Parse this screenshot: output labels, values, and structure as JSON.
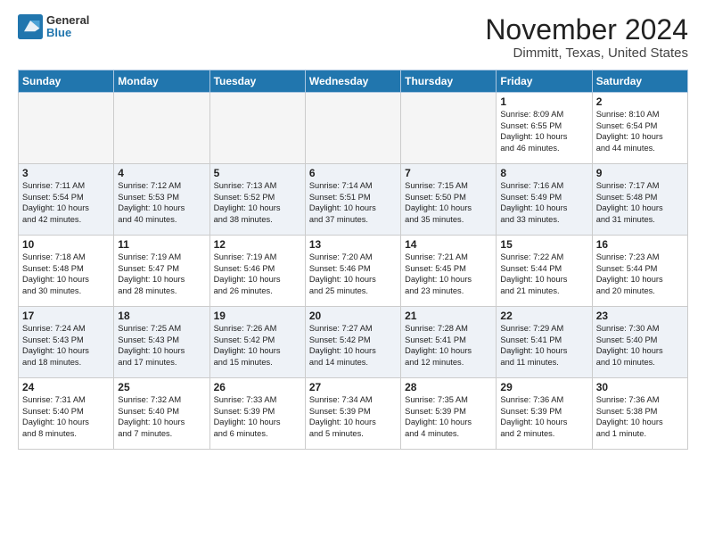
{
  "header": {
    "logo_general": "General",
    "logo_blue": "Blue",
    "title": "November 2024",
    "subtitle": "Dimmitt, Texas, United States"
  },
  "weekdays": [
    "Sunday",
    "Monday",
    "Tuesday",
    "Wednesday",
    "Thursday",
    "Friday",
    "Saturday"
  ],
  "weeks": [
    [
      {
        "day": "",
        "info": ""
      },
      {
        "day": "",
        "info": ""
      },
      {
        "day": "",
        "info": ""
      },
      {
        "day": "",
        "info": ""
      },
      {
        "day": "",
        "info": ""
      },
      {
        "day": "1",
        "info": "Sunrise: 8:09 AM\nSunset: 6:55 PM\nDaylight: 10 hours\nand 46 minutes."
      },
      {
        "day": "2",
        "info": "Sunrise: 8:10 AM\nSunset: 6:54 PM\nDaylight: 10 hours\nand 44 minutes."
      }
    ],
    [
      {
        "day": "3",
        "info": "Sunrise: 7:11 AM\nSunset: 5:54 PM\nDaylight: 10 hours\nand 42 minutes."
      },
      {
        "day": "4",
        "info": "Sunrise: 7:12 AM\nSunset: 5:53 PM\nDaylight: 10 hours\nand 40 minutes."
      },
      {
        "day": "5",
        "info": "Sunrise: 7:13 AM\nSunset: 5:52 PM\nDaylight: 10 hours\nand 38 minutes."
      },
      {
        "day": "6",
        "info": "Sunrise: 7:14 AM\nSunset: 5:51 PM\nDaylight: 10 hours\nand 37 minutes."
      },
      {
        "day": "7",
        "info": "Sunrise: 7:15 AM\nSunset: 5:50 PM\nDaylight: 10 hours\nand 35 minutes."
      },
      {
        "day": "8",
        "info": "Sunrise: 7:16 AM\nSunset: 5:49 PM\nDaylight: 10 hours\nand 33 minutes."
      },
      {
        "day": "9",
        "info": "Sunrise: 7:17 AM\nSunset: 5:48 PM\nDaylight: 10 hours\nand 31 minutes."
      }
    ],
    [
      {
        "day": "10",
        "info": "Sunrise: 7:18 AM\nSunset: 5:48 PM\nDaylight: 10 hours\nand 30 minutes."
      },
      {
        "day": "11",
        "info": "Sunrise: 7:19 AM\nSunset: 5:47 PM\nDaylight: 10 hours\nand 28 minutes."
      },
      {
        "day": "12",
        "info": "Sunrise: 7:19 AM\nSunset: 5:46 PM\nDaylight: 10 hours\nand 26 minutes."
      },
      {
        "day": "13",
        "info": "Sunrise: 7:20 AM\nSunset: 5:46 PM\nDaylight: 10 hours\nand 25 minutes."
      },
      {
        "day": "14",
        "info": "Sunrise: 7:21 AM\nSunset: 5:45 PM\nDaylight: 10 hours\nand 23 minutes."
      },
      {
        "day": "15",
        "info": "Sunrise: 7:22 AM\nSunset: 5:44 PM\nDaylight: 10 hours\nand 21 minutes."
      },
      {
        "day": "16",
        "info": "Sunrise: 7:23 AM\nSunset: 5:44 PM\nDaylight: 10 hours\nand 20 minutes."
      }
    ],
    [
      {
        "day": "17",
        "info": "Sunrise: 7:24 AM\nSunset: 5:43 PM\nDaylight: 10 hours\nand 18 minutes."
      },
      {
        "day": "18",
        "info": "Sunrise: 7:25 AM\nSunset: 5:43 PM\nDaylight: 10 hours\nand 17 minutes."
      },
      {
        "day": "19",
        "info": "Sunrise: 7:26 AM\nSunset: 5:42 PM\nDaylight: 10 hours\nand 15 minutes."
      },
      {
        "day": "20",
        "info": "Sunrise: 7:27 AM\nSunset: 5:42 PM\nDaylight: 10 hours\nand 14 minutes."
      },
      {
        "day": "21",
        "info": "Sunrise: 7:28 AM\nSunset: 5:41 PM\nDaylight: 10 hours\nand 12 minutes."
      },
      {
        "day": "22",
        "info": "Sunrise: 7:29 AM\nSunset: 5:41 PM\nDaylight: 10 hours\nand 11 minutes."
      },
      {
        "day": "23",
        "info": "Sunrise: 7:30 AM\nSunset: 5:40 PM\nDaylight: 10 hours\nand 10 minutes."
      }
    ],
    [
      {
        "day": "24",
        "info": "Sunrise: 7:31 AM\nSunset: 5:40 PM\nDaylight: 10 hours\nand 8 minutes."
      },
      {
        "day": "25",
        "info": "Sunrise: 7:32 AM\nSunset: 5:40 PM\nDaylight: 10 hours\nand 7 minutes."
      },
      {
        "day": "26",
        "info": "Sunrise: 7:33 AM\nSunset: 5:39 PM\nDaylight: 10 hours\nand 6 minutes."
      },
      {
        "day": "27",
        "info": "Sunrise: 7:34 AM\nSunset: 5:39 PM\nDaylight: 10 hours\nand 5 minutes."
      },
      {
        "day": "28",
        "info": "Sunrise: 7:35 AM\nSunset: 5:39 PM\nDaylight: 10 hours\nand 4 minutes."
      },
      {
        "day": "29",
        "info": "Sunrise: 7:36 AM\nSunset: 5:39 PM\nDaylight: 10 hours\nand 2 minutes."
      },
      {
        "day": "30",
        "info": "Sunrise: 7:36 AM\nSunset: 5:38 PM\nDaylight: 10 hours\nand 1 minute."
      }
    ]
  ]
}
